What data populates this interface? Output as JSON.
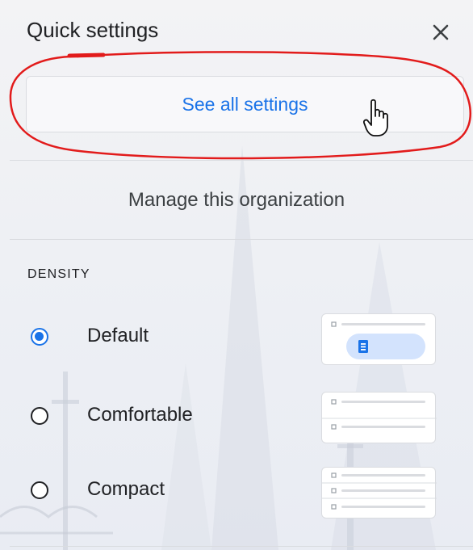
{
  "panel": {
    "title": "Quick settings",
    "close_icon": "close-icon"
  },
  "actions": {
    "see_all_label": "See all settings",
    "manage_label": "Manage this organization"
  },
  "density": {
    "heading": "DENSITY",
    "selected": "Default",
    "options": [
      {
        "label": "Default",
        "checked": true,
        "preview_icon": "density-default-preview-icon"
      },
      {
        "label": "Comfortable",
        "checked": false,
        "preview_icon": "density-comfortable-preview-icon"
      },
      {
        "label": "Compact",
        "checked": false,
        "preview_icon": "density-compact-preview-icon"
      }
    ]
  },
  "colors": {
    "accent": "#1a73e8",
    "annotation": "#e21b1b",
    "text": "#202124",
    "divider": "#dadce0"
  }
}
